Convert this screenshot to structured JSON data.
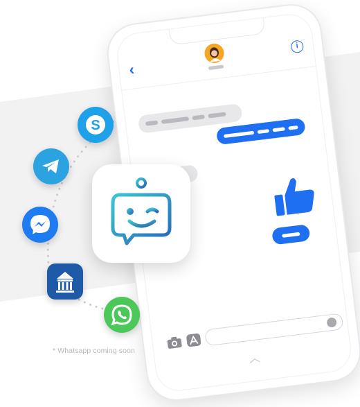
{
  "chat": {
    "back_icon": "‹",
    "info_icon": "i",
    "icons": [
      "chevron-left-icon",
      "info-icon",
      "camera-icon",
      "app-store-icon",
      "microphone-icon",
      "thumbs-up-icon"
    ]
  },
  "integrations": {
    "apps": [
      "Skype",
      "Telegram",
      "Messenger",
      "Government building app",
      "WhatsApp"
    ],
    "bot_icon": "chat-bot-icon"
  },
  "footnote": "* Whatsapp coming soon",
  "colors": {
    "accent_blue": "#1f6ff2",
    "bubble_gray": "#e8e8eb",
    "skype": "#1ea1e8",
    "telegram": "#2aa3e0",
    "messenger": "#1e7bf0",
    "gov_app": "#1f5aa6",
    "whatsapp": "#4cc85a",
    "bot_gradient_start": "#3cc7d2",
    "bot_gradient_end": "#2a66b8"
  }
}
